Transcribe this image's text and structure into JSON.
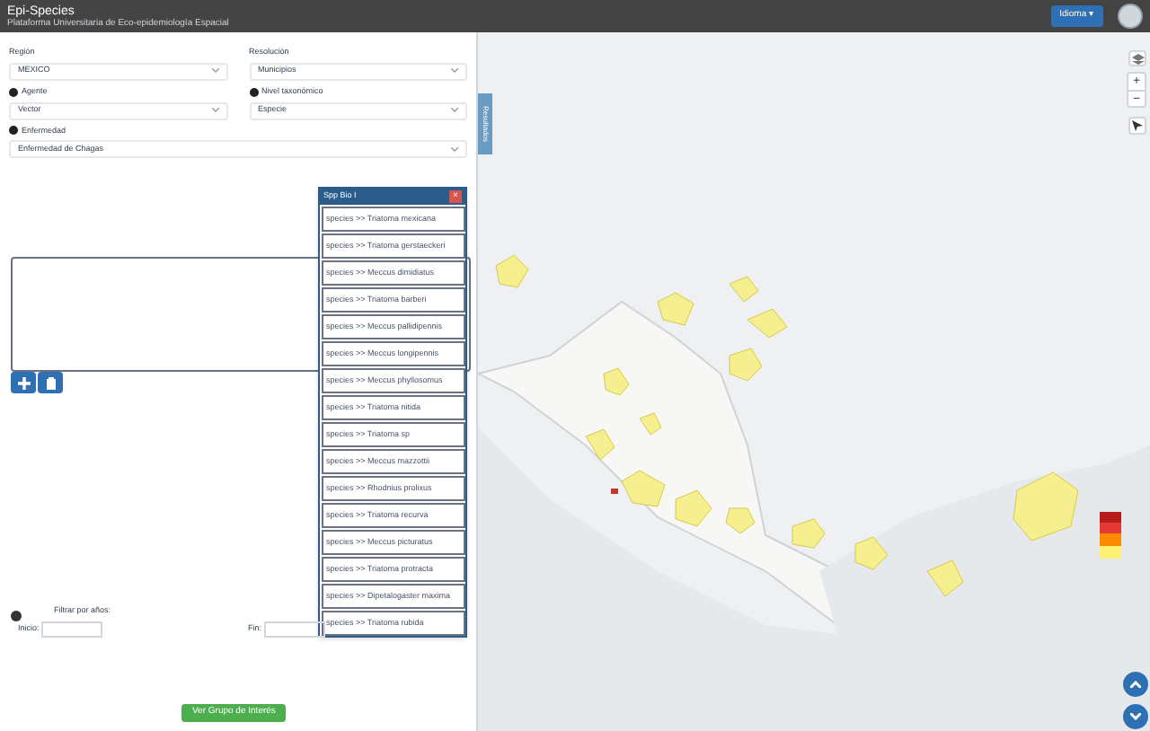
{
  "header": {
    "title": "Epi-Species",
    "subtitle": "Plataforma Universitaria de Eco-epidemiología Espacial",
    "language_button": "Idioma ▾"
  },
  "form": {
    "region": {
      "label": "Región",
      "value": "MEXICO"
    },
    "resolution": {
      "label": "Resolución",
      "value": "Municipios"
    },
    "agent": {
      "label": "Agente",
      "value": "Vector"
    },
    "taxonomic_level": {
      "label": "Nivel taxonómico",
      "value": "Especie"
    },
    "disease": {
      "label": "Enfermedad",
      "value": "Enfermedad de Chagas"
    }
  },
  "species_popup": {
    "title": "Spp Bio I",
    "close": "×",
    "items": [
      "species >> Triatoma mexicana",
      "species >> Triatoma gerstaeckeri",
      "species >> Meccus dimidiatus",
      "species >> Triatoma barberi",
      "species >> Meccus pallidipennis",
      "species >> Meccus longipennis",
      "species >> Meccus phyllosomus",
      "species >> Triatoma nitida",
      "species >> Triatoma sp",
      "species >> Meccus mazzottii",
      "species >> Rhodnius prolixus",
      "species >> Triatoma recurva",
      "species >> Meccus picturatus",
      "species >> Triatoma protracta",
      "species >> Dipetalogaster maxima",
      "species >> Triatoma rubida"
    ]
  },
  "year_filter": {
    "label": "Filtrar por años:",
    "start_label": "Inicio:",
    "end_label": "Fin:"
  },
  "submit_button": "Ver Grupo de Interés",
  "map": {
    "side_tab": "Resultados",
    "zoom_in": "+",
    "zoom_out": "−"
  }
}
